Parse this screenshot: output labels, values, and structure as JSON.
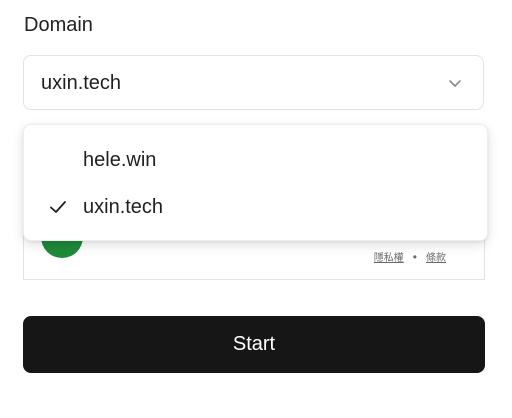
{
  "domain_field": {
    "label": "Domain",
    "selected": "uxin.tech",
    "options": [
      {
        "label": "hele.win",
        "selected": false
      },
      {
        "label": "uxin.tech",
        "selected": true
      }
    ]
  },
  "captcha_widget": {
    "links": [
      "隱私權",
      "條款"
    ]
  },
  "actions": {
    "start_label": "Start"
  },
  "colors": {
    "button_bg": "#161616",
    "check_green": "#1f8a3a"
  },
  "icons": {
    "select_toggle": "chevron-down-icon",
    "selected_option": "checkmark-icon"
  }
}
